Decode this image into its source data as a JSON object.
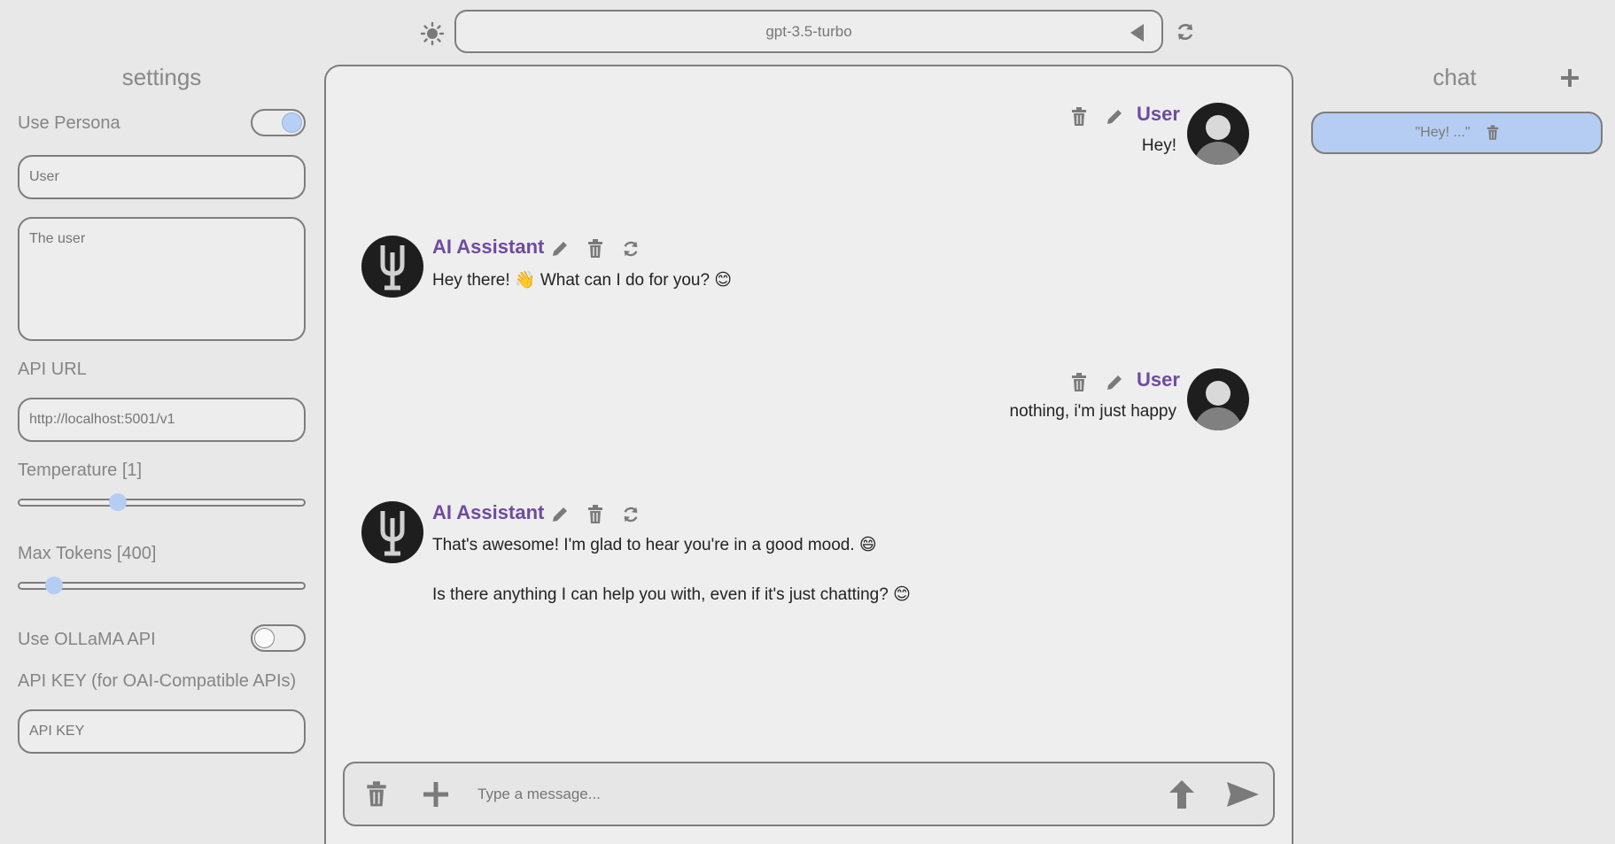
{
  "top_bar": {
    "model": "gpt-3.5-turbo",
    "theme_icon": "sun-icon",
    "refresh_icon": "refresh-icon"
  },
  "settings": {
    "title": "settings",
    "use_persona_label": "Use Persona",
    "use_persona_enabled": true,
    "persona_name_placeholder": "User",
    "persona_description_placeholder": "The user",
    "api_url_label": "API URL",
    "api_url_placeholder": "http://localhost:5001/v1",
    "temperature_label": "Temperature [1]",
    "temperature_value": 1,
    "max_tokens_label": "Max Tokens [400]",
    "max_tokens_value": 400,
    "use_ollama_label": "Use OLLaMA API",
    "use_ollama_enabled": false,
    "api_key_label": "API KEY (for OAI-Compatible APIs)",
    "api_key_placeholder": "API KEY"
  },
  "messages": [
    {
      "role": "user",
      "name": "User",
      "text": "Hey!"
    },
    {
      "role": "assistant",
      "name": "AI Assistant",
      "text": "Hey there! 👋 What can I do for you? 😊"
    },
    {
      "role": "user",
      "name": "User",
      "text": "nothing, i'm just happy"
    },
    {
      "role": "assistant",
      "name": "AI Assistant",
      "text_line1": "That's awesome! I'm glad to hear you're in a good mood. 😄",
      "text_line2": "Is there anything I can help you with, even if it's just chatting? 😊"
    }
  ],
  "composer": {
    "placeholder": "Type a message..."
  },
  "chat_list": {
    "title": "chat",
    "items": [
      {
        "label": "\"Hey! ...\""
      }
    ]
  },
  "colors": {
    "accent": "#b5cdf2",
    "name_color": "#6e4b9e",
    "background": "#e8e8e8"
  }
}
